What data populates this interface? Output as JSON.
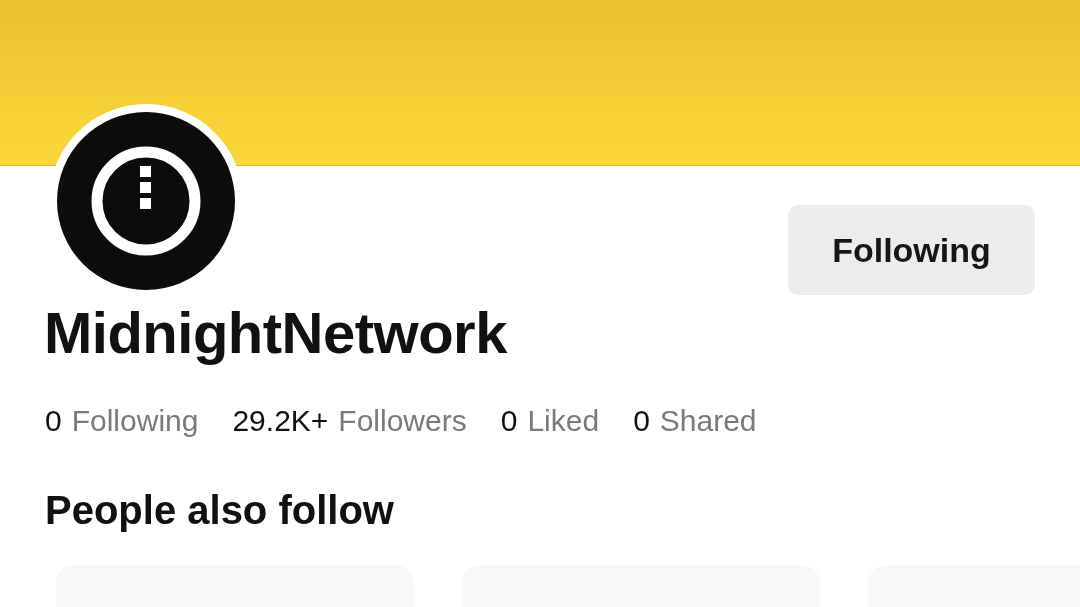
{
  "profile": {
    "name": "MidnightNetwork",
    "follow_button": {
      "label": "Following"
    }
  },
  "stats": [
    {
      "count": "0",
      "label": "Following"
    },
    {
      "count": "29.2K+",
      "label": "Followers"
    },
    {
      "count": "0",
      "label": "Liked"
    },
    {
      "count": "0",
      "label": "Shared"
    }
  ],
  "people_also_follow": {
    "title": "People also follow",
    "cards": [
      {
        "kind": "card"
      },
      {
        "kind": "card"
      },
      {
        "kind": "card"
      }
    ]
  }
}
